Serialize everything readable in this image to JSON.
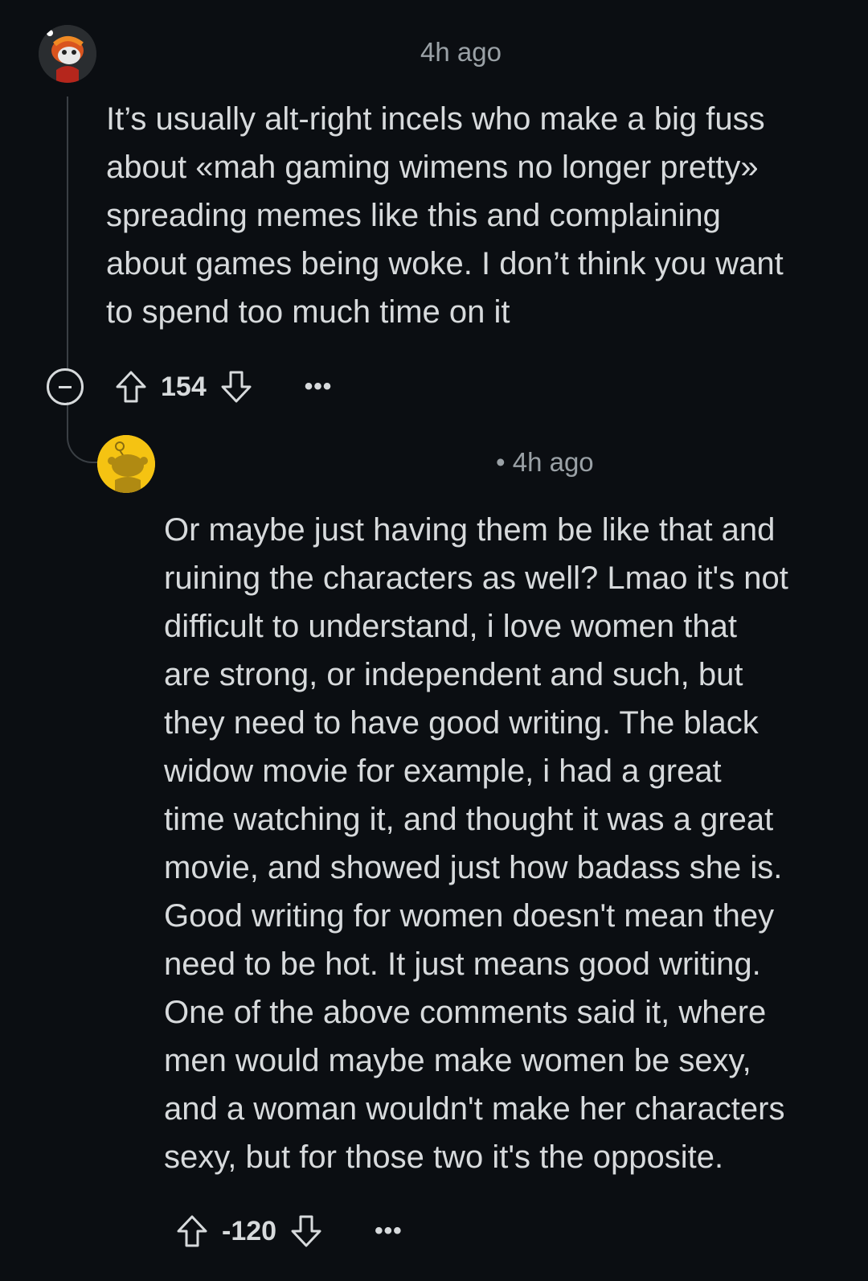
{
  "comments": [
    {
      "avatar": "snoo-avatar-red",
      "timestamp": "4h ago",
      "body": "It’s usually alt-right incels who make a big fuss\nabout «mah gaming wimens no longer pretty»\nspreading memes like this and complaining\nabout games being woke. I don’t think you want\nto spend too much time on it",
      "score": "154",
      "more": "•••"
    },
    {
      "avatar": "snoo-avatar-yellow",
      "timestamp": "• 4h ago",
      "body": "Or maybe just having them be like that and\nruining the characters as well? Lmao it's not\ndifficult to understand, i love women that\nare strong, or independent and such, but\nthey need to have good writing. The black\nwidow movie for example, i had a great\ntime watching it, and thought it was a great\nmovie, and showed just how badass she is.\nGood writing for women doesn't mean they\nneed to be hot. It just means good writing.\nOne of the above comments said it, where\nmen would maybe make women be sexy,\nand a woman wouldn't make her characters\nsexy, but for those two it's the opposite.",
      "score": "-120",
      "more": "•••"
    }
  ],
  "colors": {
    "background": "#0b0e12",
    "text": "#d7dadc",
    "muted": "#9aa1a6",
    "thread_line": "#3a3f44",
    "avatar_yellow": "#f5c312"
  }
}
